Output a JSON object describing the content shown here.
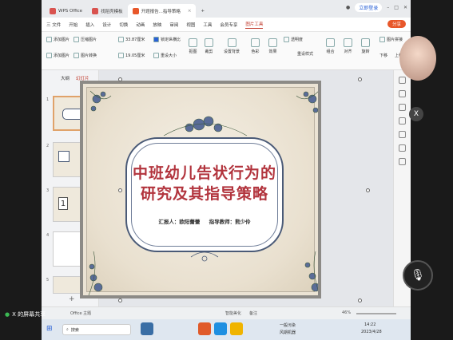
{
  "tabs": [
    {
      "label": "WPS Office",
      "color": "#d9534f"
    },
    {
      "label": "找稻壳模板",
      "color": "#d9534f"
    },
    {
      "label": "开题报告...指导策略",
      "color": "#e8572a"
    }
  ],
  "titlebar": {
    "login": "立即登录",
    "new_tab": "+"
  },
  "menu": {
    "file": "三 文件",
    "items": [
      "开始",
      "插入",
      "设计",
      "切换",
      "动画",
      "放映",
      "审阅",
      "视图",
      "工具",
      "会员专享",
      "图片工具"
    ],
    "active": "图片工具",
    "share": "分享"
  },
  "ribbon": {
    "row1": [
      "添加图片",
      "压缩图片",
      "33.87厘米",
      "锁定纵横比",
      "透明度",
      "图片拼接"
    ],
    "row2": [
      "添加图片",
      "图片转换",
      "19.05厘米",
      "重设大小",
      "抠图",
      "设置透明色",
      "色彩",
      "效果",
      "重设样式",
      "组合",
      "对齐",
      "旋转",
      "选择窗格",
      "下移",
      "上移"
    ],
    "big": [
      "抠图",
      "裁剪",
      "设置背景",
      "色彩",
      "效果",
      "重设样式",
      "组合",
      "对齐",
      "旋转"
    ]
  },
  "sidebar": {
    "tabs": [
      "大纲",
      "幻灯片"
    ],
    "active": "幻灯片",
    "numbers": [
      "1",
      "2",
      "3",
      "4",
      "5"
    ],
    "thumb3_text": "1"
  },
  "slide": {
    "title_line1": "中班幼儿告状行为的",
    "title_line2": "研究及其指导策略",
    "reporter": "汇报人：欧阳蕾蕾",
    "advisor": "指导教师：熊少伶"
  },
  "status": {
    "office_theme": "Office 主题",
    "notes": "智能美化",
    "comments": "备注",
    "zoom": "46%"
  },
  "taskbar": {
    "search": "搜索",
    "clock_time": "14:22",
    "clock_date": "2023/4/28",
    "weather": "一般污染",
    "weather2": "风期机器"
  },
  "overlay": {
    "share_label": "X 的屏幕共享",
    "close": "X"
  },
  "colors": {
    "accent": "#c0392b",
    "title_red": "#b2343d",
    "frame_blue": "#4a5a77"
  }
}
